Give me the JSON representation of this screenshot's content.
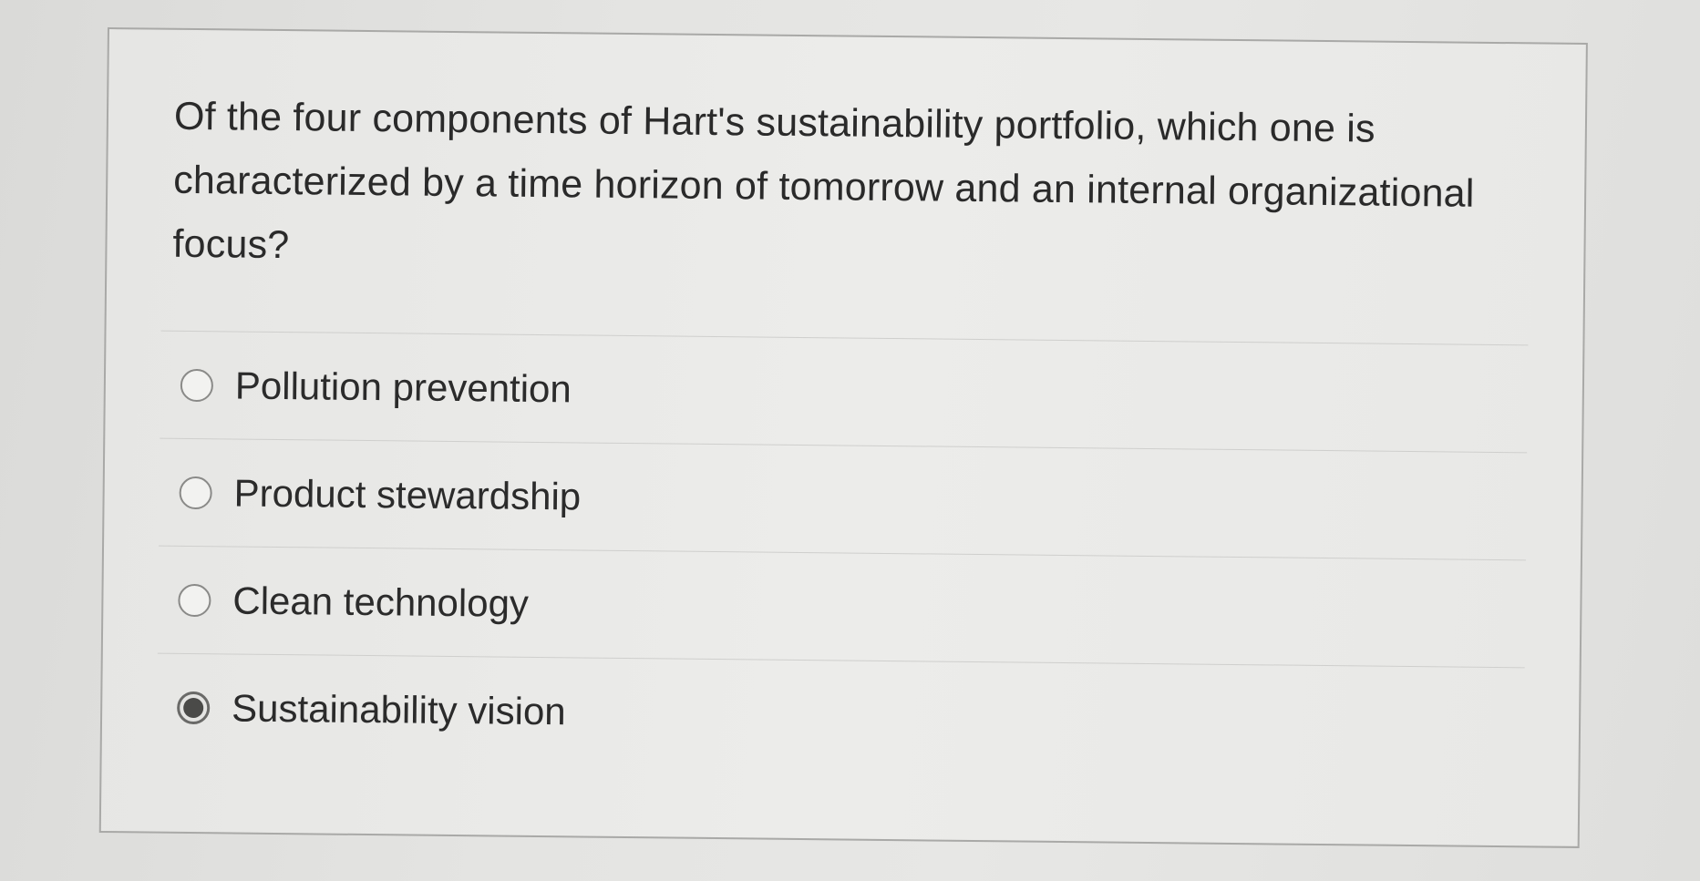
{
  "question": {
    "text": "Of the four components of Hart's sustainability portfolio, which one is characterized by a time horizon of tomorrow and an internal organizational focus?"
  },
  "options": [
    {
      "label": "Pollution prevention",
      "selected": false
    },
    {
      "label": "Product stewardship",
      "selected": false
    },
    {
      "label": "Clean technology",
      "selected": false
    },
    {
      "label": "Sustainability vision",
      "selected": true
    }
  ],
  "colors": {
    "radio_selected_fill": "#4a4a48",
    "card_border": "#a9a9a7"
  }
}
